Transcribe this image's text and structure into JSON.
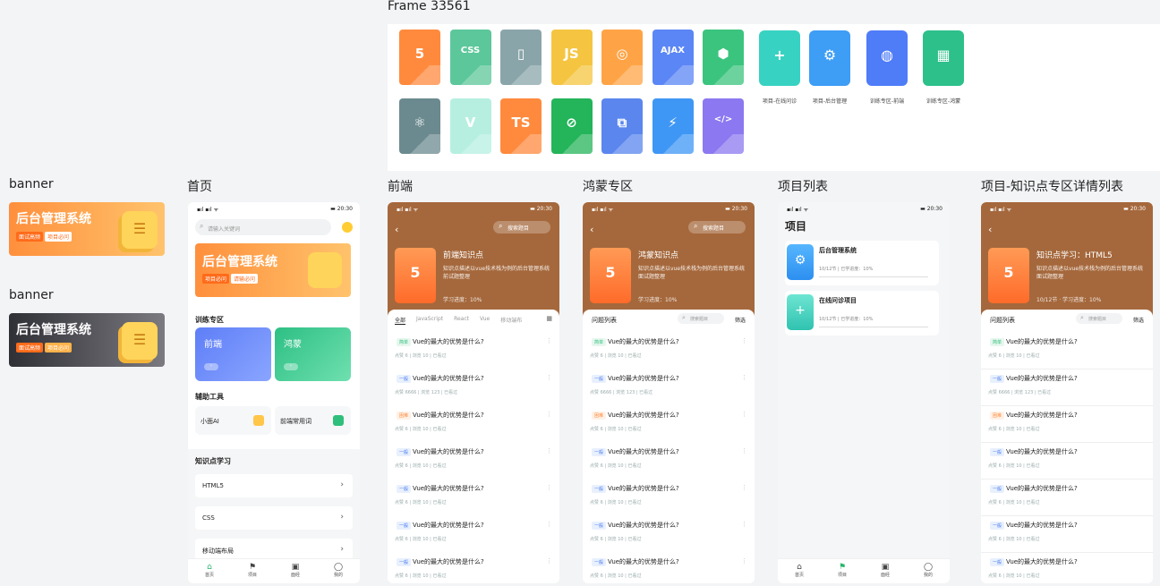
{
  "frame": {
    "label": "Frame 33561",
    "tiles_row1": [
      {
        "glyph": "5",
        "icon": "html5-icon",
        "color": "#ff8a3d"
      },
      {
        "glyph": "CSS",
        "icon": "css-icon",
        "color": "#5cc79a"
      },
      {
        "glyph": "▯",
        "icon": "mobile-icon",
        "color": "#8aa5aa"
      },
      {
        "glyph": "JS",
        "icon": "js-icon",
        "color": "#f5c542"
      },
      {
        "glyph": "◎",
        "icon": "swift-icon",
        "color": "#ffa446"
      },
      {
        "glyph": "AJAX",
        "icon": "ajax-icon",
        "color": "#5b86f5"
      },
      {
        "glyph": "⬢",
        "icon": "hexagon-icon",
        "color": "#3bc47e"
      }
    ],
    "tiles_row2": [
      {
        "glyph": "⚛",
        "icon": "react-icon",
        "color": "#6b8a8f"
      },
      {
        "glyph": "V",
        "icon": "vue-icon",
        "color": "#b6efe0"
      },
      {
        "glyph": "TS",
        "icon": "typescript-icon",
        "color": "#ff8a3d"
      },
      {
        "glyph": "⊘",
        "icon": "miniprogram-icon",
        "color": "#24b45a"
      },
      {
        "glyph": "⧉",
        "icon": "network-icon",
        "color": "#5a86ee"
      },
      {
        "glyph": "⚡",
        "icon": "flash-icon",
        "color": "#3f97f5"
      },
      {
        "glyph": "</>",
        "icon": "code-icon",
        "color": "#8c78f0"
      }
    ],
    "big_icons": [
      {
        "caption": "项目-在线问诊",
        "icon": "chat-icon",
        "color": "#38d2c2",
        "glyph": "+"
      },
      {
        "caption": "项目-后台管理",
        "icon": "gears-icon",
        "color": "#3e9df5",
        "glyph": "⚙"
      },
      {
        "caption": "训练专区-前端",
        "icon": "frontend-3d-icon",
        "color": "#4f7cf7",
        "glyph": "◍"
      },
      {
        "caption": "训练专区-鸿蒙",
        "icon": "harmony-3d-icon",
        "color": "#2dc08a",
        "glyph": "▦"
      }
    ]
  },
  "labels": {
    "banner1": "banner",
    "banner2": "banner",
    "home": "首页",
    "frontend": "前端",
    "harmony": "鸿蒙专区",
    "projects": "项目列表",
    "knowledge": "项目-知识点专区详情列表"
  },
  "banner": {
    "title": "后台管理系统",
    "tag1": "面试高频",
    "tag2": "项目必问",
    "colors": {
      "light": "#ff8f3c",
      "dark": "#3c3c44"
    }
  },
  "status": {
    "time": "20:30",
    "signal": "▪ıl ▪ıl ᯤ",
    "battery": "▬"
  },
  "home": {
    "search_placeholder": "请输入关键词",
    "banner_title": "后台管理系统",
    "banner_tag1": "项目必问",
    "banner_tag2": "请输必问",
    "train_title": "训练专区",
    "train_cards": [
      {
        "label": "前端"
      },
      {
        "label": "鸿蒙"
      }
    ],
    "tools_title": "辅助工具",
    "tools": [
      {
        "label": "小面AI"
      },
      {
        "label": "前端常用词"
      }
    ],
    "knowledge_title": "知识点学习",
    "knowledge_items": [
      "HTML5",
      "CSS",
      "移动端布局"
    ],
    "tabs": [
      "首页",
      "项目",
      "面经",
      "我的"
    ]
  },
  "detail": {
    "search_label": "搜索题目",
    "frontend_title": "前端知识点",
    "harmony_title": "鸿蒙知识点",
    "kp_title": "知识点学习：HTML5",
    "desc_frontend": "知识点描述以vue技术栈为例的后台管理系统前试题整理",
    "desc_other": "知识点描述以vue技术栈为例的后台管理系统面试题整理",
    "progress": "学习进度：10%",
    "kp_progress": "10/12节 · 学习进度：10%",
    "filter_tabs": [
      "全部",
      "JavaScript",
      "React",
      "Vue",
      "移动端布"
    ],
    "list_title": "问题列表",
    "search_small": "搜索题目",
    "filter": "筛选",
    "question": "Vue的最大的优势是什么?",
    "tags": [
      "简单",
      "一般",
      "困难",
      "一般",
      "一般",
      "一般",
      "一般"
    ],
    "tag_colors": {
      "简单": "#e6f7ee",
      "一般": "#e8f0fe",
      "困难": "#fff1e6"
    },
    "meta": [
      "点赞 6  |  浏览 10  |  已看过",
      "点赞 6666  |  浏览 123  |  已看过"
    ]
  },
  "projects": {
    "title": "项目",
    "items": [
      {
        "name": "后台管理系统",
        "progress": "10/12节 | 已学进度：10%",
        "icon": "gears-icon"
      },
      {
        "name": "在线问诊项目",
        "progress": "10/12节 | 已学进度：10%",
        "icon": "chat-icon"
      }
    ]
  }
}
